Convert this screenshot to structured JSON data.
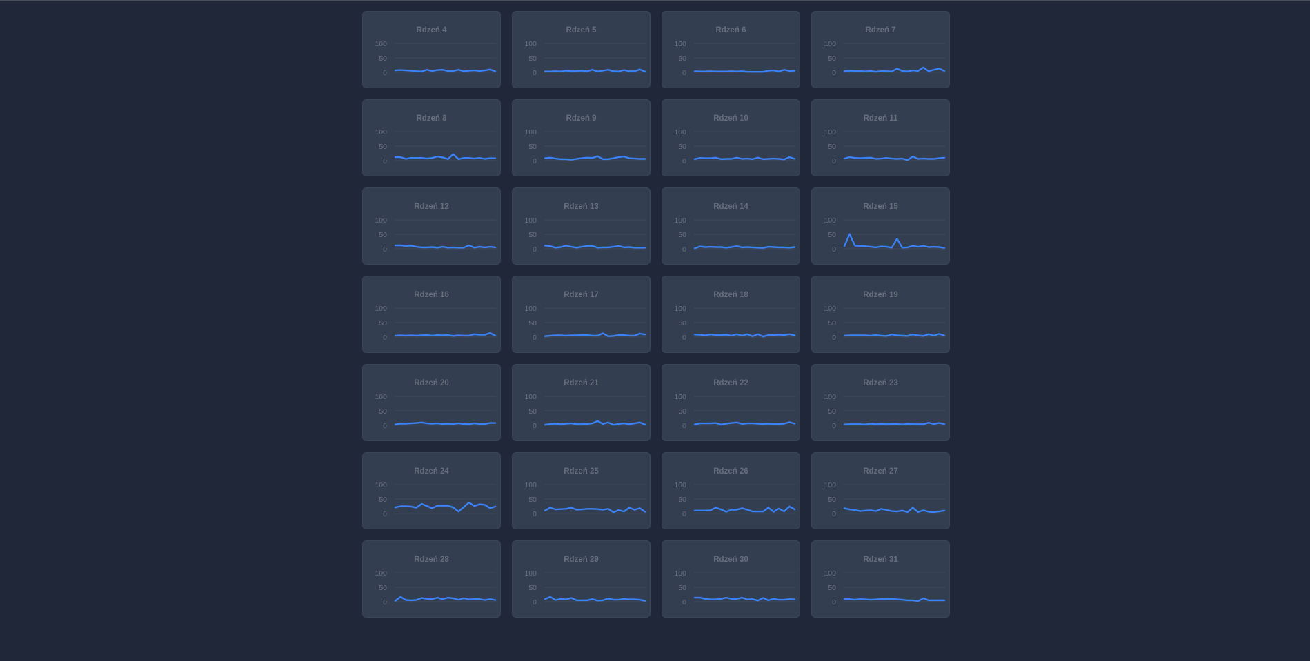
{
  "colors": {
    "background": "#1f2738",
    "card": "#343e51",
    "line": "#3b82f6",
    "grid": "#424b5c",
    "text": "#6b7280"
  },
  "chart_data": [
    {
      "type": "line",
      "title": "Rdzeń 4",
      "yticks": [
        "0",
        "50",
        "100"
      ],
      "ylim": [
        0,
        100
      ],
      "values": [
        7,
        8,
        7,
        6,
        4,
        3,
        9,
        5,
        8,
        9,
        5,
        5,
        9,
        4,
        6,
        7,
        5,
        7,
        10,
        4
      ]
    },
    {
      "type": "line",
      "title": "Rdzeń 5",
      "yticks": [
        "0",
        "50",
        "100"
      ],
      "ylim": [
        0,
        100
      ],
      "values": [
        3,
        3,
        4,
        3,
        6,
        4,
        5,
        6,
        4,
        9,
        3,
        6,
        9,
        4,
        3,
        8,
        4,
        4,
        10,
        3
      ]
    },
    {
      "type": "line",
      "title": "Rdzeń 6",
      "yticks": [
        "0",
        "50",
        "100"
      ],
      "ylim": [
        0,
        100
      ],
      "values": [
        4,
        3,
        3,
        4,
        3,
        3,
        3,
        4,
        3,
        4,
        2,
        2,
        2,
        2,
        6,
        7,
        3,
        9,
        5,
        6
      ]
    },
    {
      "type": "line",
      "title": "Rdzeń 7",
      "yticks": [
        "0",
        "50",
        "100"
      ],
      "ylim": [
        0,
        100
      ],
      "values": [
        4,
        6,
        5,
        5,
        3,
        5,
        2,
        5,
        4,
        3,
        13,
        5,
        3,
        7,
        5,
        17,
        4,
        9,
        13,
        5
      ]
    },
    {
      "type": "line",
      "title": "Rdzeń 8",
      "yticks": [
        "0",
        "50",
        "100"
      ],
      "ylim": [
        0,
        100
      ],
      "values": [
        12,
        12,
        6,
        9,
        9,
        9,
        7,
        9,
        14,
        11,
        5,
        22,
        5,
        9,
        9,
        7,
        9,
        6,
        8,
        8
      ]
    },
    {
      "type": "line",
      "title": "Rdzeń 9",
      "yticks": [
        "0",
        "50",
        "100"
      ],
      "ylim": [
        0,
        100
      ],
      "values": [
        8,
        10,
        7,
        5,
        5,
        3,
        6,
        8,
        10,
        9,
        15,
        5,
        5,
        8,
        12,
        14,
        8,
        7,
        6,
        6
      ]
    },
    {
      "type": "line",
      "title": "Rdzeń 10",
      "yticks": [
        "0",
        "50",
        "100"
      ],
      "ylim": [
        0,
        100
      ],
      "values": [
        5,
        9,
        8,
        8,
        10,
        5,
        6,
        6,
        10,
        6,
        7,
        5,
        10,
        5,
        6,
        7,
        6,
        4,
        12,
        6
      ]
    },
    {
      "type": "line",
      "title": "Rdzeń 11",
      "yticks": [
        "0",
        "50",
        "100"
      ],
      "ylim": [
        0,
        100
      ],
      "values": [
        7,
        12,
        9,
        8,
        9,
        10,
        6,
        7,
        9,
        7,
        6,
        7,
        2,
        14,
        6,
        7,
        6,
        6,
        8,
        10
      ]
    },
    {
      "type": "line",
      "title": "Rdzeń 12",
      "yticks": [
        "0",
        "50",
        "100"
      ],
      "ylim": [
        0,
        100
      ],
      "values": [
        12,
        12,
        10,
        11,
        7,
        5,
        5,
        6,
        4,
        7,
        4,
        5,
        4,
        4,
        12,
        4,
        7,
        5,
        7,
        5
      ]
    },
    {
      "type": "line",
      "title": "Rdzeń 13",
      "yticks": [
        "0",
        "50",
        "100"
      ],
      "ylim": [
        0,
        100
      ],
      "values": [
        11,
        9,
        4,
        6,
        11,
        7,
        4,
        7,
        10,
        10,
        4,
        5,
        5,
        7,
        10,
        5,
        6,
        4,
        4,
        4
      ]
    },
    {
      "type": "line",
      "title": "Rdzeń 14",
      "yticks": [
        "0",
        "50",
        "100"
      ],
      "ylim": [
        0,
        100
      ],
      "values": [
        2,
        8,
        6,
        7,
        6,
        6,
        4,
        6,
        9,
        5,
        6,
        5,
        4,
        3,
        7,
        6,
        5,
        5,
        4,
        6
      ]
    },
    {
      "type": "line",
      "title": "Rdzeń 15",
      "yticks": [
        "0",
        "50",
        "100"
      ],
      "ylim": [
        0,
        100
      ],
      "values": [
        9,
        51,
        11,
        10,
        9,
        7,
        5,
        8,
        7,
        4,
        35,
        4,
        5,
        10,
        7,
        10,
        6,
        7,
        6,
        3
      ]
    },
    {
      "type": "line",
      "title": "Rdzeń 16",
      "yticks": [
        "0",
        "50",
        "100"
      ],
      "ylim": [
        0,
        100
      ],
      "values": [
        5,
        6,
        5,
        6,
        5,
        6,
        7,
        5,
        7,
        6,
        7,
        4,
        6,
        5,
        5,
        10,
        8,
        8,
        14,
        5
      ]
    },
    {
      "type": "line",
      "title": "Rdzeń 17",
      "yticks": [
        "0",
        "50",
        "100"
      ],
      "ylim": [
        0,
        100
      ],
      "values": [
        3,
        5,
        6,
        6,
        5,
        6,
        6,
        7,
        7,
        5,
        5,
        13,
        3,
        4,
        7,
        7,
        5,
        5,
        12,
        9
      ]
    },
    {
      "type": "line",
      "title": "Rdzeń 18",
      "yticks": [
        "0",
        "50",
        "100"
      ],
      "ylim": [
        0,
        100
      ],
      "values": [
        9,
        8,
        6,
        9,
        7,
        7,
        8,
        5,
        10,
        5,
        10,
        3,
        10,
        2,
        7,
        7,
        8,
        7,
        10,
        6
      ]
    },
    {
      "type": "line",
      "title": "Rdzeń 19",
      "yticks": [
        "0",
        "50",
        "100"
      ],
      "ylim": [
        0,
        100
      ],
      "values": [
        5,
        6,
        6,
        6,
        6,
        5,
        7,
        5,
        4,
        9,
        6,
        5,
        4,
        9,
        6,
        4,
        10,
        5,
        11,
        5
      ]
    },
    {
      "type": "line",
      "title": "Rdzeń 20",
      "yticks": [
        "0",
        "50",
        "100"
      ],
      "ylim": [
        0,
        100
      ],
      "values": [
        3,
        6,
        6,
        7,
        8,
        10,
        7,
        6,
        7,
        5,
        6,
        5,
        7,
        5,
        4,
        7,
        5,
        5,
        8,
        8
      ]
    },
    {
      "type": "line",
      "title": "Rdzeń 21",
      "yticks": [
        "0",
        "50",
        "100"
      ],
      "ylim": [
        0,
        100
      ],
      "values": [
        2,
        5,
        6,
        4,
        6,
        7,
        4,
        4,
        5,
        7,
        15,
        5,
        10,
        2,
        5,
        7,
        4,
        7,
        10,
        3
      ]
    },
    {
      "type": "line",
      "title": "Rdzeń 22",
      "yticks": [
        "0",
        "50",
        "100"
      ],
      "ylim": [
        0,
        100
      ],
      "values": [
        3,
        7,
        7,
        7,
        8,
        3,
        6,
        8,
        10,
        5,
        7,
        7,
        6,
        5,
        6,
        5,
        5,
        6,
        11,
        6
      ]
    },
    {
      "type": "line",
      "title": "Rdzeń 23",
      "yticks": [
        "0",
        "50",
        "100"
      ],
      "ylim": [
        0,
        100
      ],
      "values": [
        3,
        4,
        4,
        4,
        3,
        6,
        4,
        5,
        4,
        5,
        5,
        3,
        5,
        4,
        4,
        4,
        9,
        5,
        8,
        5
      ]
    },
    {
      "type": "line",
      "title": "Rdzeń 24",
      "yticks": [
        "0",
        "50",
        "100"
      ],
      "ylim": [
        0,
        100
      ],
      "values": [
        21,
        25,
        25,
        24,
        20,
        33,
        26,
        18,
        27,
        27,
        27,
        21,
        7,
        22,
        38,
        26,
        32,
        30,
        18,
        24
      ]
    },
    {
      "type": "line",
      "title": "Rdzeń 25",
      "yticks": [
        "0",
        "50",
        "100"
      ],
      "ylim": [
        0,
        100
      ],
      "values": [
        10,
        20,
        14,
        15,
        16,
        20,
        13,
        14,
        16,
        16,
        15,
        13,
        16,
        4,
        12,
        7,
        20,
        13,
        18,
        6
      ]
    },
    {
      "type": "line",
      "title": "Rdzeń 26",
      "yticks": [
        "0",
        "50",
        "100"
      ],
      "ylim": [
        0,
        100
      ],
      "values": [
        10,
        10,
        10,
        11,
        20,
        14,
        6,
        13,
        13,
        18,
        13,
        7,
        7,
        7,
        20,
        6,
        17,
        7,
        24,
        14
      ]
    },
    {
      "type": "line",
      "title": "Rdzeń 27",
      "yticks": [
        "0",
        "50",
        "100"
      ],
      "ylim": [
        0,
        100
      ],
      "values": [
        18,
        14,
        12,
        8,
        10,
        11,
        8,
        16,
        12,
        8,
        7,
        10,
        5,
        20,
        5,
        11,
        6,
        5,
        7,
        10
      ]
    },
    {
      "type": "line",
      "title": "Rdzeń 28",
      "yticks": [
        "0",
        "50",
        "100"
      ],
      "ylim": [
        0,
        100
      ],
      "values": [
        3,
        17,
        6,
        5,
        6,
        13,
        10,
        9,
        14,
        9,
        14,
        12,
        7,
        12,
        8,
        9,
        9,
        6,
        9,
        6
      ]
    },
    {
      "type": "line",
      "title": "Rdzeń 29",
      "yticks": [
        "0",
        "50",
        "100"
      ],
      "ylim": [
        0,
        100
      ],
      "values": [
        9,
        17,
        6,
        10,
        8,
        13,
        5,
        5,
        5,
        9,
        4,
        5,
        11,
        7,
        7,
        10,
        8,
        8,
        7,
        3
      ]
    },
    {
      "type": "line",
      "title": "Rdzeń 30",
      "yticks": [
        "0",
        "50",
        "100"
      ],
      "ylim": [
        0,
        100
      ],
      "values": [
        14,
        14,
        10,
        8,
        8,
        10,
        14,
        10,
        10,
        14,
        8,
        9,
        4,
        13,
        5,
        10,
        7,
        7,
        9,
        8
      ]
    },
    {
      "type": "line",
      "title": "Rdzeń 31",
      "yticks": [
        "0",
        "50",
        "100"
      ],
      "ylim": [
        0,
        100
      ],
      "values": [
        9,
        9,
        7,
        9,
        8,
        7,
        8,
        9,
        9,
        10,
        8,
        7,
        5,
        5,
        2,
        12,
        5,
        5,
        5,
        5
      ]
    }
  ]
}
